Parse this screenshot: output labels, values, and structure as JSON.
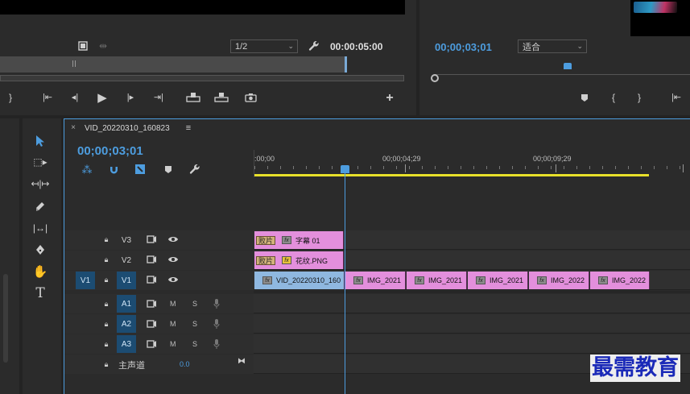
{
  "program_monitor": {
    "resolution": "1/2",
    "duration_timecode": "00:00:05:00"
  },
  "source_monitor": {
    "timecode": "00;00;03;01",
    "fit": "适合"
  },
  "timeline": {
    "sequence_name": "VID_20220310_160823",
    "timecode": "00;00;03;01",
    "ruler": [
      ":00;00",
      "00;00;04;29",
      "00;00;09;29"
    ],
    "tracks": {
      "v3": "V3",
      "v2": "V2",
      "v1": "V1",
      "v1_source": "V1",
      "a1": "A1",
      "a2": "A2",
      "a3": "A3",
      "mute": "M",
      "solo": "S",
      "master": "主声道",
      "master_value": "0.0"
    },
    "clips": {
      "v3": {
        "tag": "败片",
        "name": "字幕 01"
      },
      "v2": {
        "tag": "败片",
        "name": "花纹.PNG"
      },
      "v1": [
        "VID_20220310_160",
        "IMG_2021",
        "IMG_2021",
        "IMG_2021",
        "IMG_2022",
        "IMG_2022"
      ],
      "fx": "fx"
    }
  },
  "watermark": "最需教育",
  "colors": {
    "accent": "#4d9ddf",
    "clip": "#e38fdc",
    "clip_v1": "#8fb8e0",
    "playhead": "#4d9ddf",
    "work_area": "#e8e02a"
  },
  "icons": [
    "film-icon",
    "wrench-icon",
    "play-icon",
    "step-back-icon",
    "step-forward-icon",
    "camera-icon",
    "plus-icon",
    "marker-icon",
    "selection-tool-icon",
    "hand-tool-icon",
    "type-tool-icon",
    "pen-tool-icon",
    "razor-tool-icon",
    "lock-icon",
    "eye-icon",
    "mic-icon"
  ]
}
